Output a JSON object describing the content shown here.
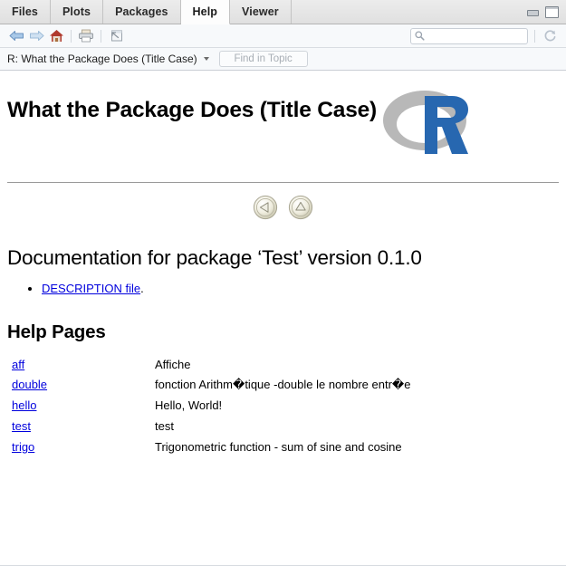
{
  "window": {
    "tabs": [
      {
        "label": "Files",
        "active": false
      },
      {
        "label": "Plots",
        "active": false
      },
      {
        "label": "Packages",
        "active": false
      },
      {
        "label": "Help",
        "active": true
      },
      {
        "label": "Viewer",
        "active": false
      }
    ],
    "minimize_icon": "minimize-icon",
    "maximize_icon": "maximize-icon"
  },
  "toolbar": {
    "back_icon": "back-arrow-icon",
    "forward_icon": "forward-arrow-icon",
    "home_icon": "home-icon",
    "print_icon": "print-icon",
    "popout_icon": "show-in-new-window-icon",
    "search_icon": "search-icon",
    "search_value": "",
    "search_placeholder": "",
    "refresh_icon": "refresh-icon"
  },
  "addressbar": {
    "topic": "R: What the Package Does (Title Case)",
    "dropdown_icon": "chevron-down-icon",
    "find_value": "",
    "find_placeholder": "Find in Topic"
  },
  "document": {
    "title": "What the Package Does (Title Case)",
    "logo": "r-logo",
    "nav": {
      "back_icon": "left-arrow-circle-icon",
      "up_icon": "up-arrow-circle-icon"
    },
    "section_heading": "Documentation for package ‘Test’ version 0.1.0",
    "description_link": "DESCRIPTION file",
    "description_suffix": ".",
    "help_pages_heading": "Help Pages",
    "help_pages": [
      {
        "name": "aff",
        "description": "Affiche"
      },
      {
        "name": "double",
        "description": "fonction Arithm�tique -double le nombre entr�e"
      },
      {
        "name": "hello",
        "description": "Hello, World!"
      },
      {
        "name": "test",
        "description": "test"
      },
      {
        "name": "trigo",
        "description": "Trigonometric function - sum of sine and cosine"
      }
    ]
  },
  "colors": {
    "link": "#0000dd",
    "r_blue": "#2767b0",
    "r_gray": "#b3b3b3",
    "tab_active_bg": "#fdfdfd",
    "tabstrip_bg": "#e1e1e1"
  }
}
